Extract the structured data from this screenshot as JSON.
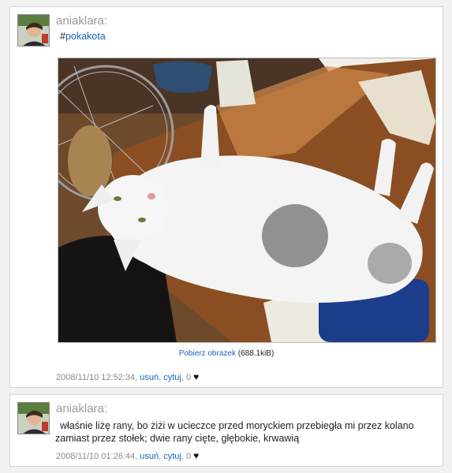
{
  "posts": [
    {
      "username": "aniaklara:",
      "hash": "#",
      "tag": "pokakota",
      "download_link": "Pobierz obrazek",
      "download_size": "(688.1kiB)",
      "timestamp": "2008/11/10 12:52:34,",
      "delete_label": "usuń",
      "quote_label": "cytuj",
      "like_count": "0",
      "icon": "heart-icon"
    },
    {
      "username": "aniaklara:",
      "text": "właśnie liżę rany, bo żiżi w ucieczce przed moryckiem przebiegła mi przez kolano zamiast przez stołek; dwie rany cięte, głębokie, krwawią",
      "timestamp": "2008/11/10 01:26:44,",
      "delete_label": "usuń",
      "quote_label": "cytuj",
      "like_count": "0",
      "icon": "heart-icon"
    }
  ],
  "colors": {
    "link": "#1b64b8",
    "username": "#9a9a9a",
    "meta": "#8a8a8a"
  }
}
